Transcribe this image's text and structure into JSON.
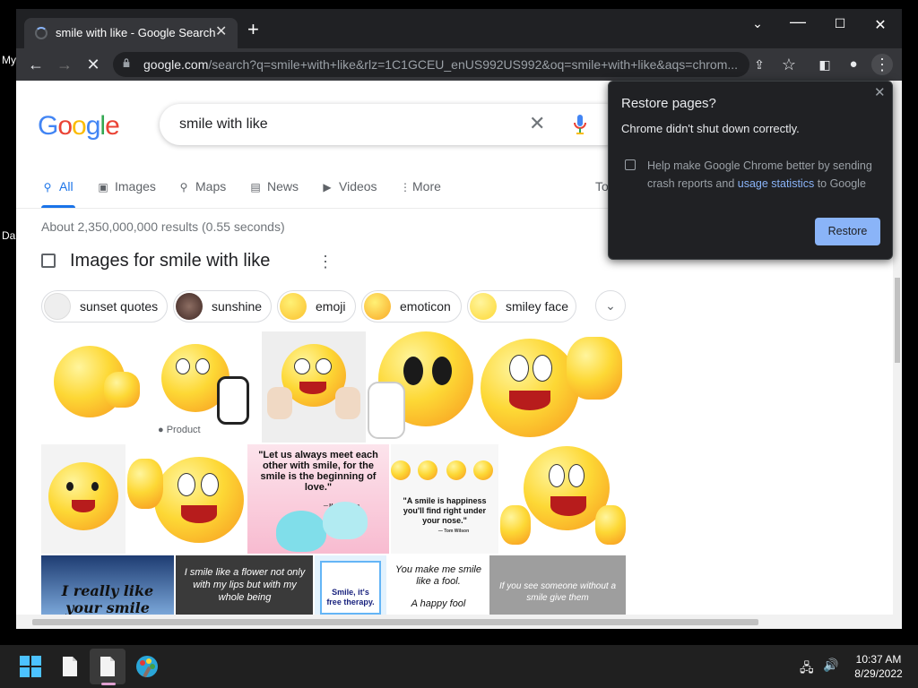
{
  "desktop": {
    "label1": "My",
    "label2": "Da"
  },
  "tab": {
    "title": "smile with like - Google Search",
    "close": "✕"
  },
  "toolbar": {
    "url_host": "google.com",
    "url_path": "/search?q=smile+with+like&rlz=1C1GCEU_enUS992US992&oq=smile+with+like&aqs=chrom..."
  },
  "search": {
    "query": "smile with like"
  },
  "nav": {
    "tabs": [
      {
        "label": "All",
        "icon": "search-icon"
      },
      {
        "label": "Images",
        "icon": "image-icon"
      },
      {
        "label": "Maps",
        "icon": "map-pin-icon"
      },
      {
        "label": "News",
        "icon": "news-icon"
      },
      {
        "label": "Videos",
        "icon": "video-icon"
      },
      {
        "label": "More",
        "icon": "kebab-icon"
      }
    ],
    "tools_partial": "To"
  },
  "results_stats": "About 2,350,000,000 results (0.55 seconds)",
  "images_heading": "Images for smile with like",
  "chips": [
    "sunset quotes",
    "sunshine",
    "emoji",
    "emoticon",
    "smiley face"
  ],
  "tiles": {
    "product_tag": "Product",
    "quote1": "\"Let us always meet each other with smile, for the smile is the beginning of love.\"",
    "quote1_author": "— Mother Teresa",
    "quote2": "\"A smile is happiness you'll find right under your nose.\"",
    "quote2_author": "— Tom Wilson",
    "quote3": "I really like your smile",
    "quote4": "I smile like a flower not only with my lips but with my whole being",
    "quote5": "Smile, it's free therapy.",
    "quote6a": "You make me smile like a fool.",
    "quote6b": "A happy fool",
    "quote7": "If you see someone without a smile give them"
  },
  "popup": {
    "title": "Restore pages?",
    "subtitle": "Chrome didn't shut down correctly.",
    "help_pre": "Help make Google Chrome better by sending crash reports and ",
    "help_link": "usage statistics",
    "help_post": " to Google",
    "button": "Restore"
  },
  "taskbar": {
    "time": "10:37 AM",
    "date": "8/29/2022"
  },
  "colors": {
    "accent": "#1a73e8",
    "popup_button": "#8ab4f8",
    "chrome_dark": "#202124"
  }
}
